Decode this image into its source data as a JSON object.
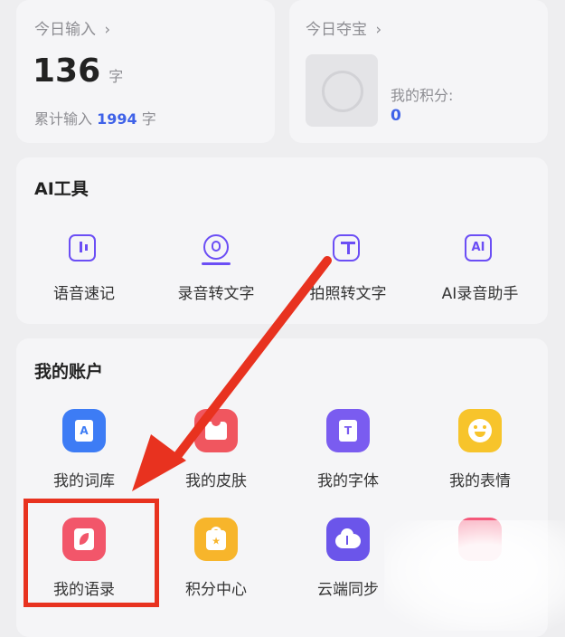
{
  "today_input": {
    "title": "今日输入",
    "chevron": "›",
    "count": "136",
    "unit": "字",
    "total_prefix": "累计输入",
    "total_value": "1994",
    "total_unit": "字"
  },
  "today_treasure": {
    "title": "今日夺宝",
    "chevron": "›",
    "points_label": "我的积分:",
    "points_value": "0"
  },
  "ai_tools": {
    "title": "AI工具",
    "items": [
      {
        "label": "语音速记",
        "icon": "voice-note-icon"
      },
      {
        "label": "录音转文字",
        "icon": "record-to-text-icon"
      },
      {
        "label": "拍照转文字",
        "icon": "photo-to-text-icon"
      },
      {
        "label": "AI录音助手",
        "icon": "ai-recorder-icon"
      }
    ]
  },
  "account": {
    "title": "我的账户",
    "items": [
      {
        "label": "我的词库",
        "icon": "lexicon-icon",
        "color": "#3d7cf5"
      },
      {
        "label": "我的皮肤",
        "icon": "skin-icon",
        "color": "#f0565f"
      },
      {
        "label": "我的字体",
        "icon": "font-icon",
        "color": "#7a5cf0"
      },
      {
        "label": "我的表情",
        "icon": "emoji-icon",
        "color": "#f7c42b"
      },
      {
        "label": "我的语录",
        "icon": "quote-icon",
        "color": "#f2566a"
      },
      {
        "label": "积分中心",
        "icon": "points-center-icon",
        "color": "#f7b52b"
      },
      {
        "label": "云端同步",
        "icon": "cloud-sync-icon",
        "color": "#6b55ea"
      },
      {
        "label": "",
        "icon": "app-icon",
        "color": "#f4587a"
      }
    ]
  },
  "colors": {
    "accent_blue": "#3f62e8",
    "annotation_red": "#e8321f"
  }
}
